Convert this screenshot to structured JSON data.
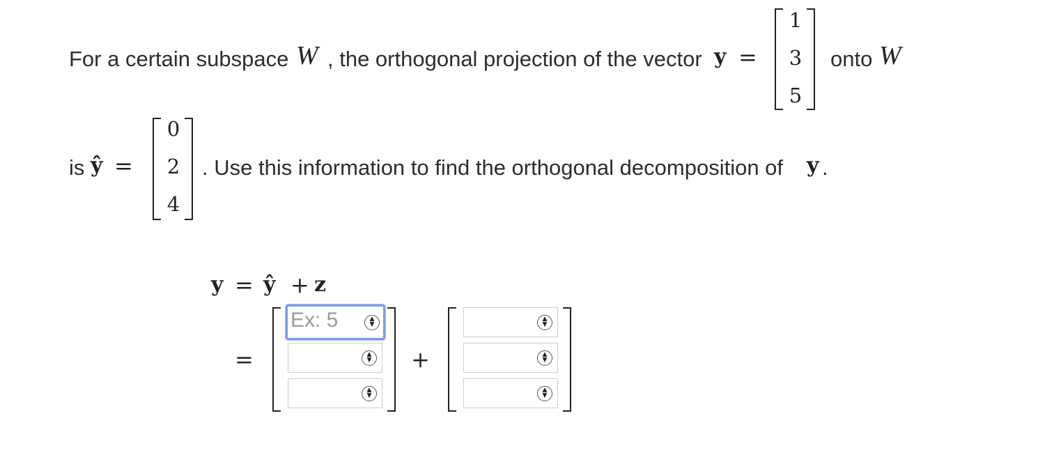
{
  "problem": {
    "line1_text": "For a certain subspace",
    "line1_W": "W",
    "line1_text2": ", the orthogonal projection of the vector",
    "y_symbol": "y",
    "equals": "=",
    "y_vector": [
      "1",
      "3",
      "5"
    ],
    "onto_text": "onto",
    "onto_W": "W",
    "line2_is": "is",
    "yhat_symbol": "ŷ",
    "yhat_vector": [
      "0",
      "2",
      "4"
    ],
    "line2_text": ". Use this information to find the orthogonal decomposition of",
    "line2_y": "y",
    "line2_period": "."
  },
  "equation": {
    "y": "y",
    "equals": "=",
    "yhat": "ŷ",
    "plus": "+",
    "z": "z",
    "equals2": "=",
    "plus2": "+"
  },
  "inputs": {
    "first_vector": [
      {
        "value": "",
        "placeholder": "Ex: 5"
      },
      {
        "value": "",
        "placeholder": ""
      },
      {
        "value": "",
        "placeholder": ""
      }
    ],
    "second_vector": [
      {
        "value": "",
        "placeholder": ""
      },
      {
        "value": "",
        "placeholder": ""
      },
      {
        "value": "",
        "placeholder": ""
      }
    ],
    "spinner_icon": "up-down-arrows",
    "focus_color": "#7e9be6"
  }
}
